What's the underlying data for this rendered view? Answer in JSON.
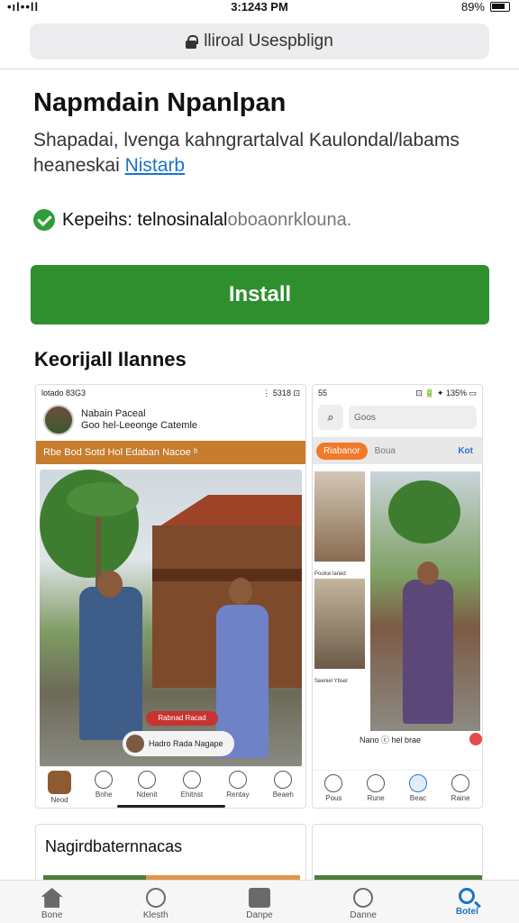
{
  "status_bar": {
    "signal": "•ıl••ll",
    "time": "3:1243 PM",
    "right": "89%"
  },
  "browser": {
    "url": "lliroal Usespblign"
  },
  "app": {
    "title": "Napmdain Npanlpan",
    "description": "Shapadai, lvenga kahngrartalval Kaulondal/labams heaneskai",
    "description_link": "Nistarb",
    "verified_strong": "Kepeihs: telnosinalal",
    "verified_muted": "oboaonrklouna."
  },
  "install": {
    "label": "Install"
  },
  "screenshots": {
    "title": "Keorijall Ilannes",
    "shot1": {
      "status_left": "lotado 83G3",
      "status_right": "⋮ 5318 ⊡",
      "header_name": "Nabain Paceal",
      "header_sub": "Goo hel-Leeonge Catemle",
      "banner": "Rbe Bod  Sotd  Hol  Edaban Nacoe ᵇ",
      "tag": "Rabnad Racad",
      "caption": "Hadro Rada Nagape",
      "nav": [
        "Neod",
        "Bnhe",
        "Ndenit",
        "Ehitnst",
        "Rentay",
        "Beaeh"
      ]
    },
    "shot2": {
      "status_left": "55",
      "status_right": "⊡ 🔋 ✦ 135% ▭",
      "search_field": "Goos",
      "tab_active": "Riabanor",
      "tab_2": "Boua",
      "tab_3": "Kot",
      "caption_1": "Poolce laned",
      "caption_2": "Seeniel Ybsel",
      "meta": "Nano  ⓒ hel brae",
      "nav": [
        "Pous",
        "Rune",
        "Beac",
        "Raine"
      ]
    },
    "card_a_title": "Nagirdbaternnacas"
  },
  "bottom_nav": {
    "items": [
      {
        "label": "Bone",
        "icon": "home-icon"
      },
      {
        "label": "Klesth",
        "icon": "compass-icon"
      },
      {
        "label": "Danpe",
        "icon": "apps-icon"
      },
      {
        "label": "Danne",
        "icon": "games-icon"
      },
      {
        "label": "Botel",
        "icon": "search-icon"
      }
    ]
  }
}
